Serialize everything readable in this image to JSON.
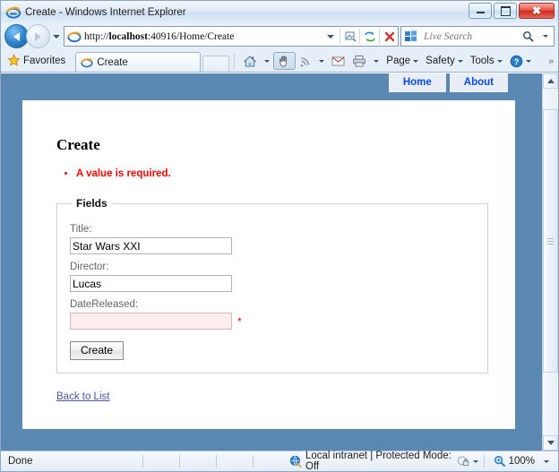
{
  "window": {
    "title": "Create - Windows Internet Explorer",
    "app_icon": "ie-logo-icon",
    "minimize_label": "Minimize",
    "maximize_label": "Maximize",
    "close_label": "Close"
  },
  "address_bar": {
    "back_label": "Back",
    "forward_label": "Forward",
    "url_full": "http://localhost:40916/Home/Create",
    "url_scheme": "http://",
    "url_host": "localhost",
    "url_path": ":40916/Home/Create",
    "compat_icon": "compatibility-view-icon",
    "refresh_icon": "refresh-icon",
    "stop_icon": "stop-icon",
    "search_placeholder": "Live Search",
    "search_icon": "search-icon"
  },
  "command_bar": {
    "favorites_label": "Favorites",
    "favorites_icon": "star-icon",
    "tab_label": "Create",
    "tab_icon": "ie-logo-icon",
    "new_tab_label": "New Tab",
    "home_icon": "home-icon",
    "caret_browsing_icon": "hand-icon",
    "feeds_icon": "rss-icon",
    "mail_icon": "mail-icon",
    "print_icon": "printer-icon",
    "items": [
      {
        "label": "Page"
      },
      {
        "label": "Safety"
      },
      {
        "label": "Tools"
      }
    ],
    "help_icon": "help-icon",
    "overflow_label": "»"
  },
  "page": {
    "nav": [
      {
        "label": "Home"
      },
      {
        "label": "About"
      }
    ],
    "heading": "Create",
    "validation_summary": [
      "A value is required."
    ],
    "fieldset_legend": "Fields",
    "fields": [
      {
        "label": "Title:",
        "value": "Star Wars XXI",
        "error": false,
        "required_marker": ""
      },
      {
        "label": "Director:",
        "value": "Lucas",
        "error": false,
        "required_marker": ""
      },
      {
        "label": "DateReleased:",
        "value": "",
        "error": true,
        "required_marker": "*"
      }
    ],
    "submit_label": "Create",
    "back_link_label": "Back to List"
  },
  "status_bar": {
    "status": "Done",
    "zone": "Local intranet | Protected Mode: Off",
    "zone_icon": "intranet-icon",
    "privacy_icon": "privacy-lock-icon",
    "zoom_icon": "zoom-magnifier-icon",
    "zoom_level": "100%"
  },
  "colors": {
    "page_background": "#5b87b3",
    "nav_link": "#034af3",
    "error_text": "#ff0000",
    "error_field_bg": "#fdeded",
    "link": "#4a54a5"
  }
}
